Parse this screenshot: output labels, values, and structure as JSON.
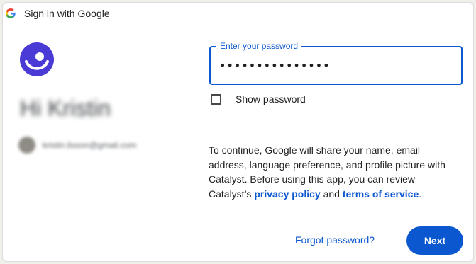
{
  "window": {
    "title": "Sign in with Google"
  },
  "account": {
    "greeting": "Hi Kristin",
    "email": "kristin.lisson@gmail.com"
  },
  "password": {
    "label": "Enter your password",
    "value": "•••••••••••••••"
  },
  "show_password": {
    "label": "Show password",
    "checked": false
  },
  "consent": {
    "text": "To continue, Google will share your name, email address, language preference, and profile picture with Catalyst. Before using this app, you can review Catalyst’s ",
    "privacy_link": "privacy policy",
    "and": " and ",
    "terms_link": "terms of service",
    "end": "."
  },
  "actions": {
    "forgot_label": "Forgot password?",
    "next_label": "Next"
  },
  "colors": {
    "accent": "#0b57d0",
    "app_logo": "#4b3bd6"
  },
  "icons": {
    "window": "google-g-icon",
    "app": "catalyst-logo-icon"
  }
}
